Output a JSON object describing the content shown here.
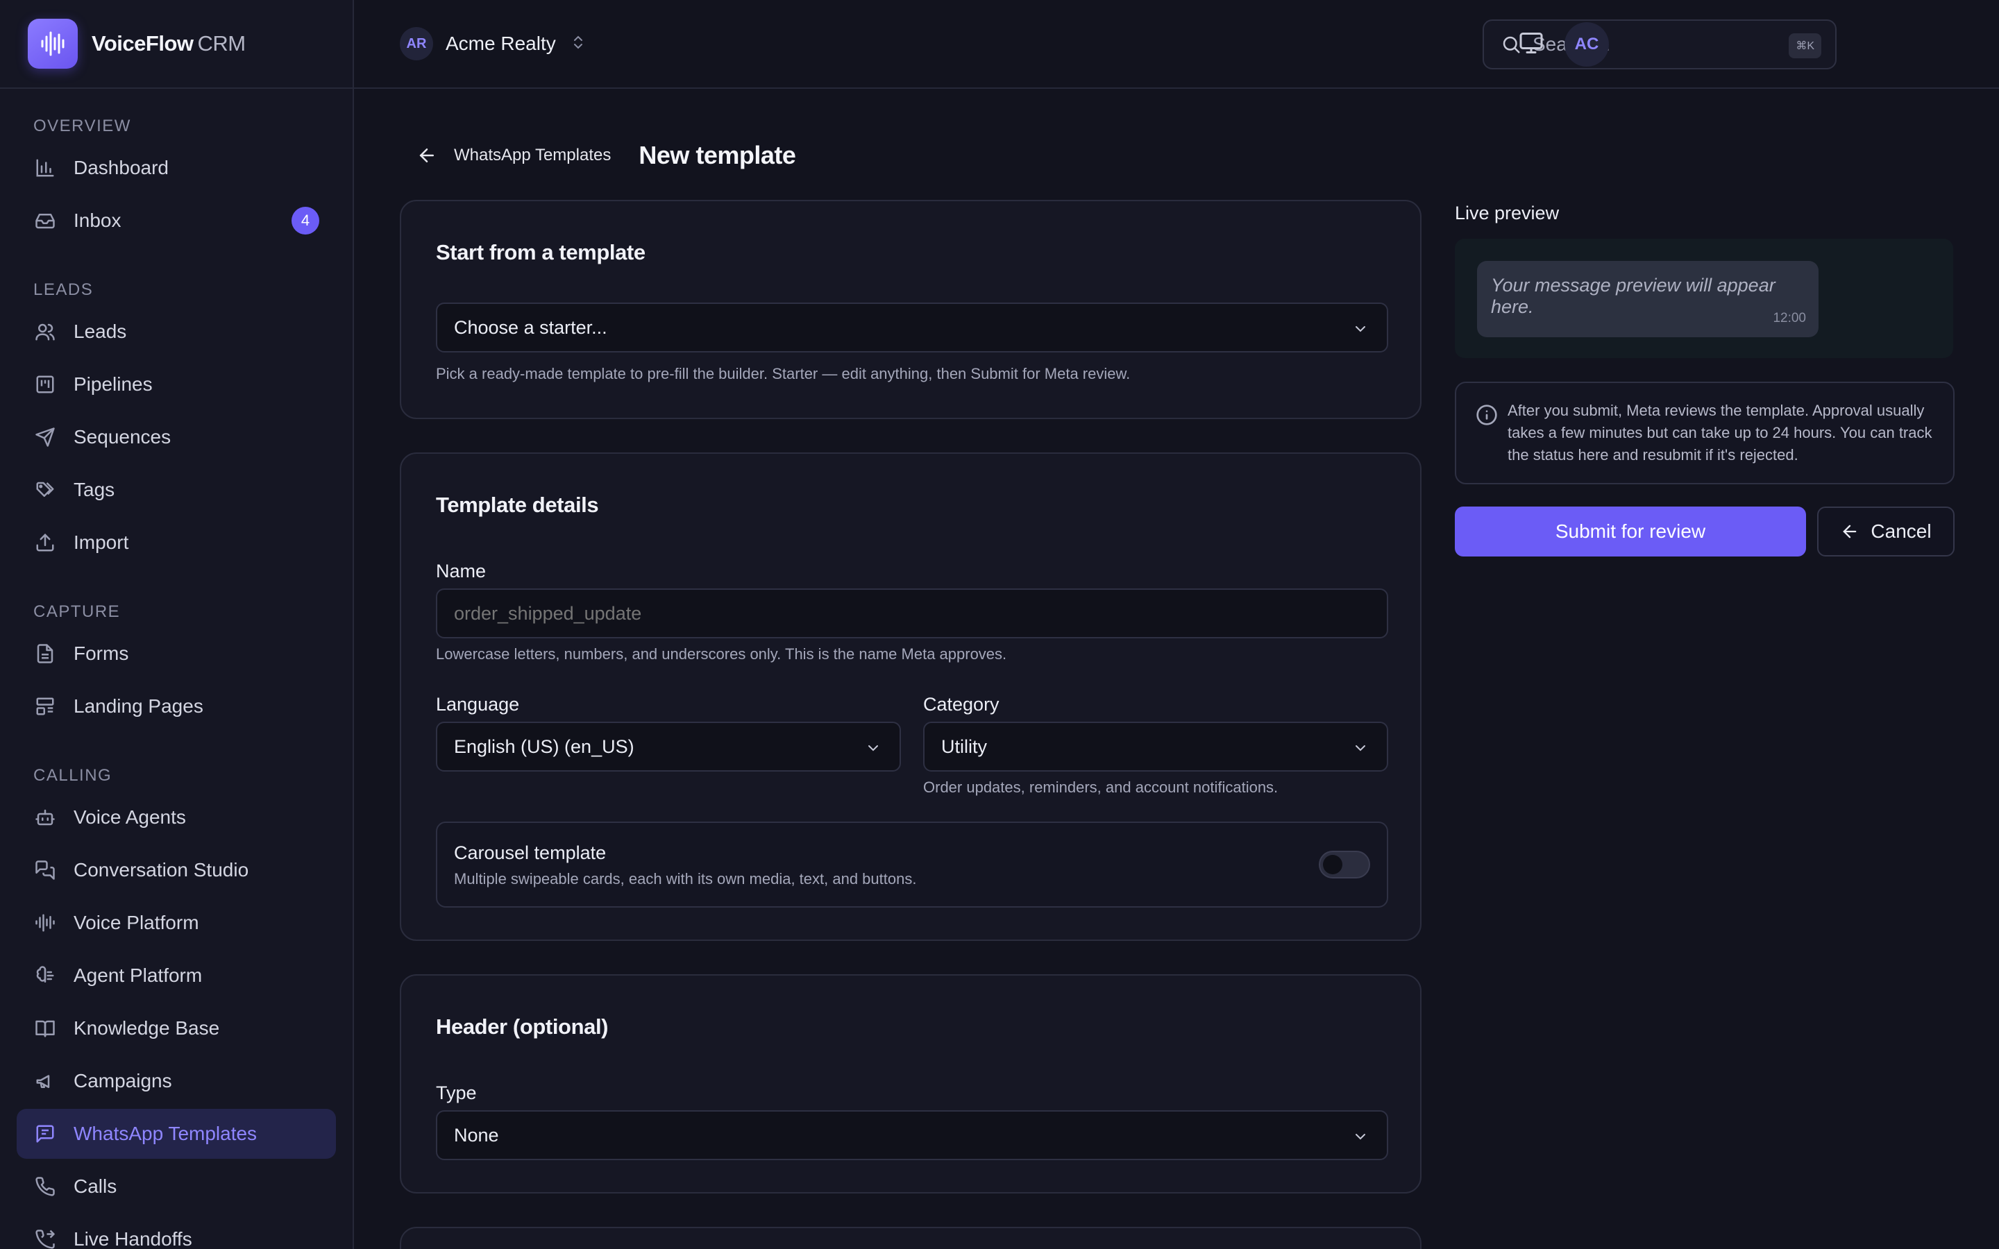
{
  "brand": {
    "name": "VoiceFlow",
    "suffix": "CRM"
  },
  "sidebar": {
    "sections": [
      {
        "title": "OVERVIEW",
        "items": [
          {
            "label": "Dashboard",
            "icon": "bar-chart-icon"
          },
          {
            "label": "Inbox",
            "icon": "inbox-icon",
            "badge": "4"
          }
        ]
      },
      {
        "title": "LEADS",
        "items": [
          {
            "label": "Leads",
            "icon": "users-icon"
          },
          {
            "label": "Pipelines",
            "icon": "kanban-icon"
          },
          {
            "label": "Sequences",
            "icon": "send-icon"
          },
          {
            "label": "Tags",
            "icon": "tags-icon"
          },
          {
            "label": "Import",
            "icon": "upload-icon"
          }
        ]
      },
      {
        "title": "CAPTURE",
        "items": [
          {
            "label": "Forms",
            "icon": "file-text-icon"
          },
          {
            "label": "Landing Pages",
            "icon": "layout-icon"
          }
        ]
      },
      {
        "title": "CALLING",
        "items": [
          {
            "label": "Voice Agents",
            "icon": "bot-icon"
          },
          {
            "label": "Conversation Studio",
            "icon": "messages-icon"
          },
          {
            "label": "Voice Platform",
            "icon": "audio-lines-icon"
          },
          {
            "label": "Agent Platform",
            "icon": "brain-icon"
          },
          {
            "label": "Knowledge Base",
            "icon": "book-icon"
          },
          {
            "label": "Campaigns",
            "icon": "megaphone-icon"
          },
          {
            "label": "WhatsApp Templates",
            "icon": "message-square-icon",
            "active": true
          },
          {
            "label": "Calls",
            "icon": "phone-icon"
          },
          {
            "label": "Live Handoffs",
            "icon": "phone-forward-icon"
          }
        ]
      }
    ]
  },
  "topbar": {
    "workspace_initials": "AR",
    "workspace_name": "Acme Realty",
    "search_placeholder": "Search...",
    "search_shortcut": "⌘K",
    "user_initials": "AC"
  },
  "breadcrumb": {
    "back_label": "WhatsApp Templates",
    "title": "New template"
  },
  "starter_card": {
    "title": "Start from a template",
    "select_value": "Choose a starter...",
    "hint": "Pick a ready-made template to pre-fill the builder. Starter — edit anything, then Submit for Meta review."
  },
  "details_card": {
    "title": "Template details",
    "name_label": "Name",
    "name_placeholder": "order_shipped_update",
    "name_hint": "Lowercase letters, numbers, and underscores only. This is the name Meta approves.",
    "language_label": "Language",
    "language_value": "English (US) (en_US)",
    "category_label": "Category",
    "category_value": "Utility",
    "category_hint": "Order updates, reminders, and account notifications.",
    "carousel_title": "Carousel template",
    "carousel_desc": "Multiple swipeable cards, each with its own media, text, and buttons.",
    "carousel_enabled": false
  },
  "header_card": {
    "title": "Header (optional)",
    "type_label": "Type",
    "type_value": "None"
  },
  "preview": {
    "label": "Live preview",
    "message": "Your message preview will appear here.",
    "time": "12:00"
  },
  "info": {
    "text": "After you submit, Meta reviews the template. Approval usually takes a few minutes but can take up to 24 hours. You can track the status here and resubmit if it's rejected."
  },
  "actions": {
    "submit_label": "Submit for review",
    "cancel_label": "Cancel"
  },
  "colors": {
    "accent": "#6b5cf6",
    "background": "#12131e",
    "card": "#161724"
  }
}
